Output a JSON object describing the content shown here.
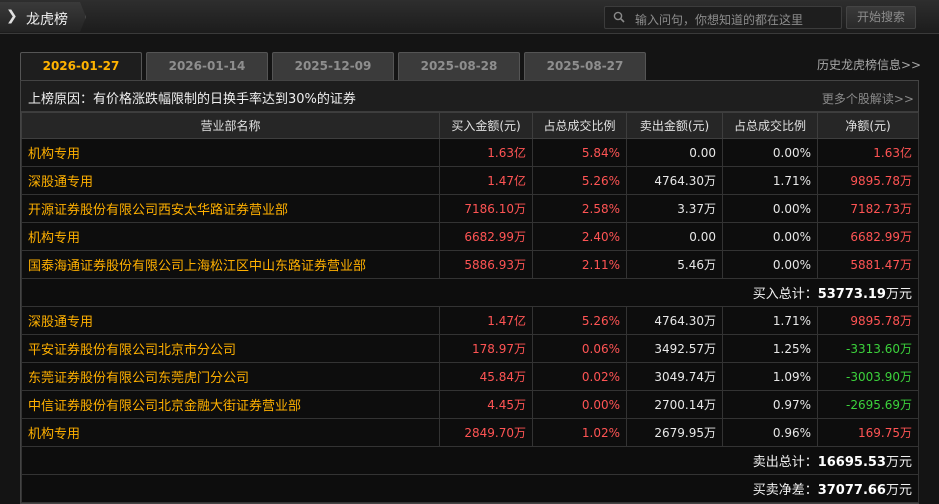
{
  "topbar": {
    "title": "龙虎榜",
    "search_placeholder": "输入问句，你想知道的都在这里",
    "search_button": "开始搜索"
  },
  "tabs": [
    "2026-01-27",
    "2026-01-14",
    "2025-12-09",
    "2025-08-28",
    "2025-08-27"
  ],
  "active_tab": 0,
  "history_link": "历史龙虎榜信息>>",
  "reason": {
    "prefix": "上榜原因：",
    "text": "有价格涨跌幅限制的日换手率达到30%的证券"
  },
  "more_link": "更多个股解读>>",
  "columns": [
    "营业部名称",
    "买入金额(元)",
    "占总成交比例",
    "卖出金额(元)",
    "占总成交比例",
    "净额(元)"
  ],
  "buy_rows": [
    {
      "name": "机构专用",
      "buy": "1.63亿",
      "buy_pct": "5.84%",
      "sell": "0.00",
      "sell_pct": "0.00%",
      "net": "1.63亿",
      "net_neg": false
    },
    {
      "name": "深股通专用",
      "buy": "1.47亿",
      "buy_pct": "5.26%",
      "sell": "4764.30万",
      "sell_pct": "1.71%",
      "net": "9895.78万",
      "net_neg": false
    },
    {
      "name": "开源证券股份有限公司西安太华路证券营业部",
      "buy": "7186.10万",
      "buy_pct": "2.58%",
      "sell": "3.37万",
      "sell_pct": "0.00%",
      "net": "7182.73万",
      "net_neg": false
    },
    {
      "name": "机构专用",
      "buy": "6682.99万",
      "buy_pct": "2.40%",
      "sell": "0.00",
      "sell_pct": "0.00%",
      "net": "6682.99万",
      "net_neg": false
    },
    {
      "name": "国泰海通证券股份有限公司上海松江区中山东路证券营业部",
      "buy": "5886.93万",
      "buy_pct": "2.11%",
      "sell": "5.46万",
      "sell_pct": "0.00%",
      "net": "5881.47万",
      "net_neg": false
    }
  ],
  "buy_total": {
    "label": "买入总计：",
    "value": "53773.19",
    "unit": "万元"
  },
  "sell_rows": [
    {
      "name": "深股通专用",
      "buy": "1.47亿",
      "buy_pct": "5.26%",
      "sell": "4764.30万",
      "sell_pct": "1.71%",
      "net": "9895.78万",
      "net_neg": false
    },
    {
      "name": "平安证券股份有限公司北京市分公司",
      "buy": "178.97万",
      "buy_pct": "0.06%",
      "sell": "3492.57万",
      "sell_pct": "1.25%",
      "net": "-3313.60万",
      "net_neg": true
    },
    {
      "name": "东莞证券股份有限公司东莞虎门分公司",
      "buy": "45.84万",
      "buy_pct": "0.02%",
      "sell": "3049.74万",
      "sell_pct": "1.09%",
      "net": "-3003.90万",
      "net_neg": true
    },
    {
      "name": "中信证券股份有限公司北京金融大街证券营业部",
      "buy": "4.45万",
      "buy_pct": "0.00%",
      "sell": "2700.14万",
      "sell_pct": "0.97%",
      "net": "-2695.69万",
      "net_neg": true
    },
    {
      "name": "机构专用",
      "buy": "2849.70万",
      "buy_pct": "1.02%",
      "sell": "2679.95万",
      "sell_pct": "0.96%",
      "net": "169.75万",
      "net_neg": false
    }
  ],
  "sell_total": {
    "label": "卖出总计：",
    "value": "16695.53",
    "unit": "万元"
  },
  "net_total": {
    "label": "买卖净差：",
    "value": "37077.66",
    "unit": "万元"
  },
  "colors": {
    "accent": "#ffb300",
    "up": "#ff5454",
    "down": "#3cd23c",
    "name": "#ffb000"
  }
}
